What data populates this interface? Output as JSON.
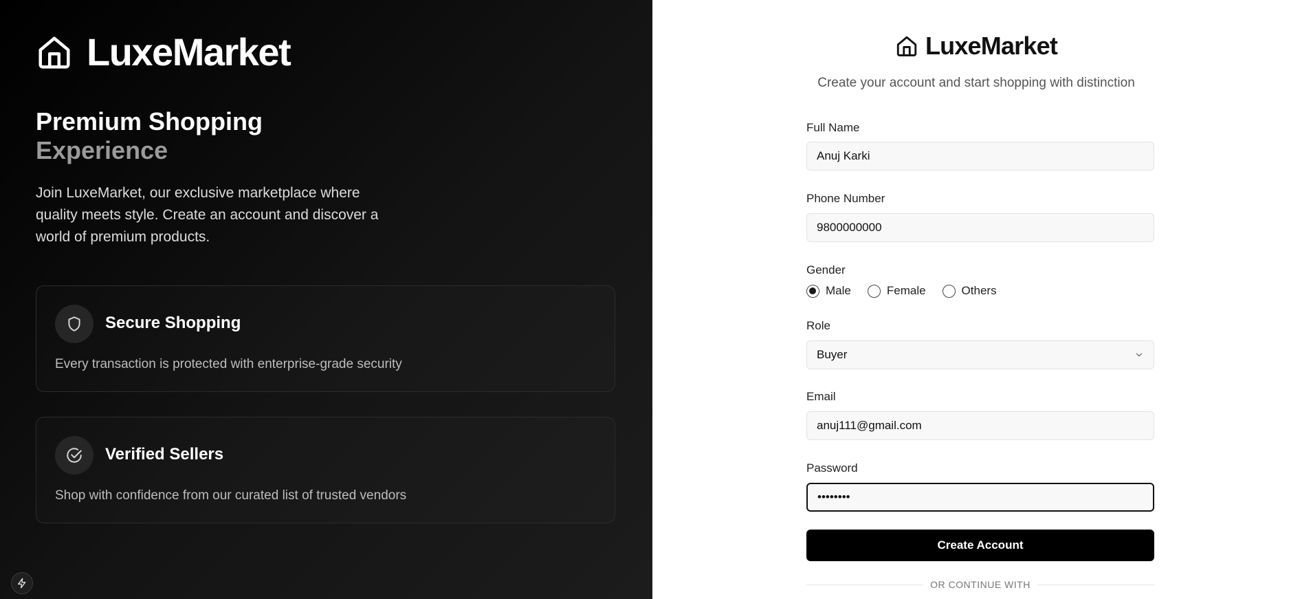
{
  "brand": {
    "name": "LuxeMarket"
  },
  "left": {
    "headline_line1": "Premium Shopping",
    "headline_line2": "Experience",
    "intro": "Join LuxeMarket, our exclusive marketplace where quality meets style. Create an account and discover a world of premium products.",
    "features": [
      {
        "title": "Secure Shopping",
        "description": "Every transaction is protected with enterprise-grade security",
        "icon": "shield-icon"
      },
      {
        "title": "Verified Sellers",
        "description": "Shop with confidence from our curated list of trusted vendors",
        "icon": "check-circle-icon"
      }
    ]
  },
  "form": {
    "subtitle": "Create your account and start shopping with distinction",
    "full_name": {
      "label": "Full Name",
      "value": "Anuj Karki"
    },
    "phone": {
      "label": "Phone Number",
      "value": "9800000000"
    },
    "gender": {
      "label": "Gender",
      "options": [
        "Male",
        "Female",
        "Others"
      ],
      "selected": "Male"
    },
    "role": {
      "label": "Role",
      "value": "Buyer"
    },
    "email": {
      "label": "Email",
      "value": "anuj111@gmail.com"
    },
    "password": {
      "label": "Password",
      "value": "••••••••"
    },
    "submit_label": "Create Account",
    "divider_text": "OR CONTINUE WITH"
  },
  "colors": {
    "left_bg": "#000000",
    "accent": "#000000",
    "muted": "#9a9a9a"
  }
}
